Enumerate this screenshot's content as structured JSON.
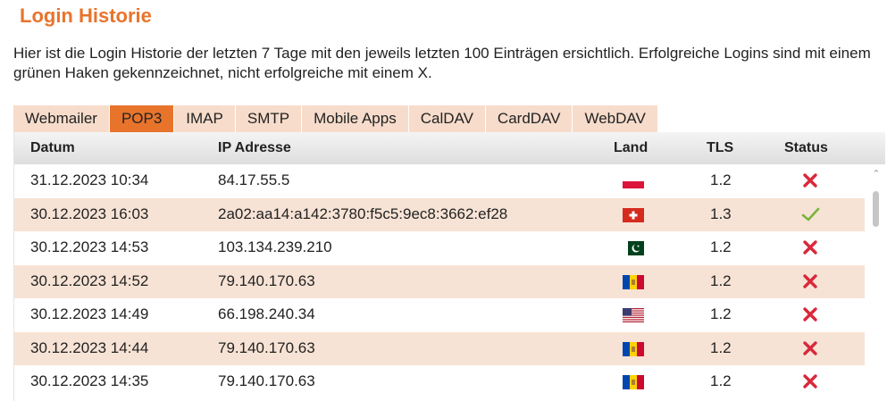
{
  "title": "Login Historie",
  "intro": "Hier ist die Login Historie der letzten 7 Tage mit den jeweils letzten 100 Einträgen ersichtlich. Erfolgreiche Logins sind mit einem grünen Haken gekennzeichnet, nicht erfolgreiche mit einem X.",
  "tabs": [
    {
      "label": "Webmailer",
      "active": false
    },
    {
      "label": "POP3",
      "active": true
    },
    {
      "label": "IMAP",
      "active": false
    },
    {
      "label": "SMTP",
      "active": false
    },
    {
      "label": "Mobile Apps",
      "active": false
    },
    {
      "label": "CalDAV",
      "active": false
    },
    {
      "label": "CardDAV",
      "active": false
    },
    {
      "label": "WebDAV",
      "active": false
    }
  ],
  "columns": {
    "datum": "Datum",
    "ip": "IP Adresse",
    "land": "Land",
    "tls": "TLS",
    "status": "Status"
  },
  "rows": [
    {
      "datum": "31.12.2023 10:34",
      "ip": "84.17.55.5",
      "land": "poland-flag-icon",
      "tls": "1.2",
      "status": "fail"
    },
    {
      "datum": "30.12.2023 16:03",
      "ip": "2a02:aa14:a142:3780:f5c5:9ec8:3662:ef28",
      "land": "switzerland-flag-icon",
      "tls": "1.3",
      "status": "success"
    },
    {
      "datum": "30.12.2023 14:53",
      "ip": "103.134.239.210",
      "land": "pakistan-flag-icon",
      "tls": "1.2",
      "status": "fail"
    },
    {
      "datum": "30.12.2023 14:52",
      "ip": "79.140.170.63",
      "land": "moldova-flag-icon",
      "tls": "1.2",
      "status": "fail"
    },
    {
      "datum": "30.12.2023 14:49",
      "ip": "66.198.240.34",
      "land": "usa-flag-icon",
      "tls": "1.2",
      "status": "fail"
    },
    {
      "datum": "30.12.2023 14:44",
      "ip": "79.140.170.63",
      "land": "moldova-flag-icon",
      "tls": "1.2",
      "status": "fail"
    },
    {
      "datum": "30.12.2023 14:35",
      "ip": "79.140.170.63",
      "land": "moldova-flag-icon",
      "tls": "1.2",
      "status": "fail"
    }
  ],
  "colors": {
    "accent": "#e8742c",
    "tab_bg": "#f7dccb",
    "row_alt": "#f7e3d5",
    "fail": "#d9283a",
    "success": "#78b43a"
  }
}
